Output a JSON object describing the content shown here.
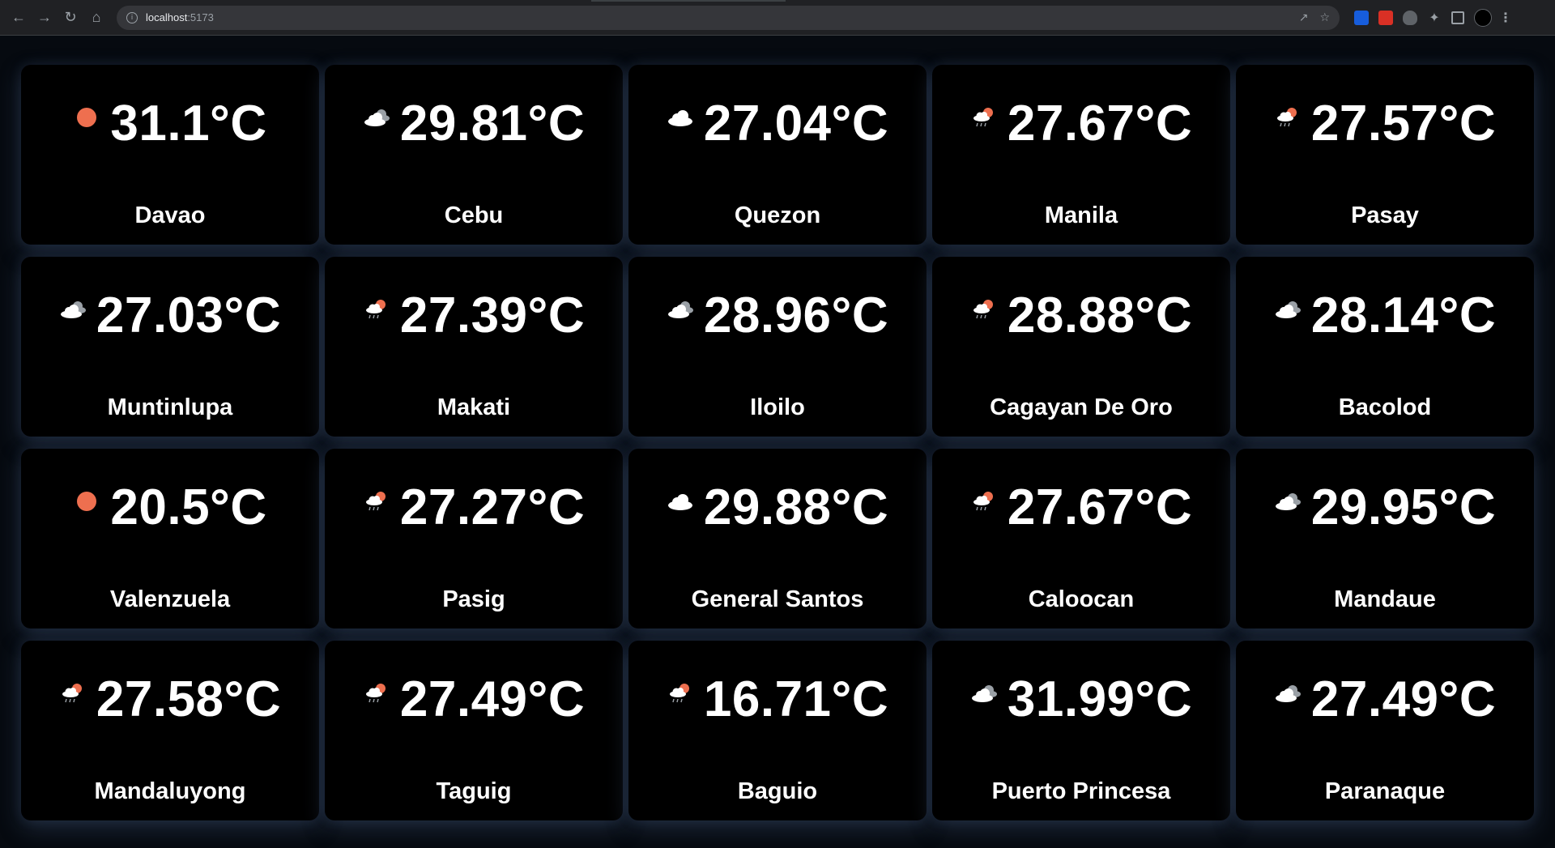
{
  "browser": {
    "url_host": "localhost",
    "url_port": ":5173"
  },
  "colors": {
    "sun": "#ee6f4f",
    "cloud": "#ffffff",
    "dark_cloud": "#9aa0a6",
    "background": "#000000"
  },
  "cities": [
    {
      "name": "Davao",
      "temp": "31.1°C",
      "icon": "sun-icon"
    },
    {
      "name": "Cebu",
      "temp": "29.81°C",
      "icon": "dark-clouds-icon"
    },
    {
      "name": "Quezon",
      "temp": "27.04°C",
      "icon": "cloud-icon"
    },
    {
      "name": "Manila",
      "temp": "27.67°C",
      "icon": "sun-rain-icon"
    },
    {
      "name": "Pasay",
      "temp": "27.57°C",
      "icon": "sun-rain-icon"
    },
    {
      "name": "Muntinlupa",
      "temp": "27.03°C",
      "icon": "dark-clouds-icon"
    },
    {
      "name": "Makati",
      "temp": "27.39°C",
      "icon": "sun-rain-icon"
    },
    {
      "name": "Iloilo",
      "temp": "28.96°C",
      "icon": "dark-clouds-icon"
    },
    {
      "name": "Cagayan De Oro",
      "temp": "28.88°C",
      "icon": "sun-rain-icon"
    },
    {
      "name": "Bacolod",
      "temp": "28.14°C",
      "icon": "dark-clouds-icon"
    },
    {
      "name": "Valenzuela",
      "temp": "20.5°C",
      "icon": "sun-icon"
    },
    {
      "name": "Pasig",
      "temp": "27.27°C",
      "icon": "sun-rain-icon"
    },
    {
      "name": "General Santos",
      "temp": "29.88°C",
      "icon": "cloud-icon"
    },
    {
      "name": "Caloocan",
      "temp": "27.67°C",
      "icon": "sun-rain-icon"
    },
    {
      "name": "Mandaue",
      "temp": "29.95°C",
      "icon": "dark-clouds-icon"
    },
    {
      "name": "Mandaluyong",
      "temp": "27.58°C",
      "icon": "sun-rain-icon"
    },
    {
      "name": "Taguig",
      "temp": "27.49°C",
      "icon": "sun-rain-icon"
    },
    {
      "name": "Baguio",
      "temp": "16.71°C",
      "icon": "sun-rain-icon"
    },
    {
      "name": "Puerto Princesa",
      "temp": "31.99°C",
      "icon": "dark-clouds-icon"
    },
    {
      "name": "Paranaque",
      "temp": "27.49°C",
      "icon": "dark-clouds-icon"
    }
  ]
}
